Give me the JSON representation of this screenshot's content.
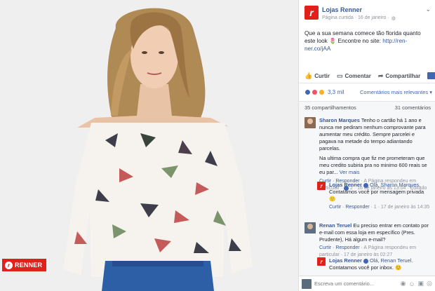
{
  "photo": {
    "brand_badge": "RENNER",
    "colors": {
      "background": "#efefef",
      "brand_red": "#e1201b",
      "denim": "#2d5fa6",
      "hair": "#b08a55"
    }
  },
  "post": {
    "page_name": "Lojas Renner",
    "meta": "Página curtida · 16 de janeiro · ",
    "caption_text": "Que a sua semana comece tão florida quanto este look 🌷 Encontre no site: ",
    "caption_link": "http://ren-ner.co/jAA",
    "actions": {
      "like": "Curtir",
      "comment": "Comentar",
      "share": "Compartilhar"
    },
    "reactions_count": "3,3 mil",
    "relevance_label": "Comentários mais relevantes",
    "shares_label": "35 compartilhamentos",
    "comments_label": "31 comentários"
  },
  "comments": [
    {
      "author": "Sharon Marques",
      "text": "Tenho o cartão há 1 ano e nunca me pediram nenhum comprovante para aumentar meu crédito. Sempre parcelei e pagava na metade do tempo adiantando parcelas.",
      "text2": "Na ultima compra que fiz me prometeram que meu credito subiria pra no minimo 600 reais se eu par... ",
      "more": "Ver mais",
      "footer_links": "Curtir · Responder",
      "footer_meta": " · A Página respondeu em particular · ",
      "footer_tail": "2 · 16 de janeiro às 13:04 · Editado"
    },
    {
      "author": "Lojas Renner",
      "mention": "Olá, Sharon Marques.",
      "text": " Contatamos você por mensagem privada 🙂",
      "footer_links": "Curtir · Responder",
      "footer_meta": " · 1 · 17 de janeiro às 14:35"
    },
    {
      "author": "Renan Teruel",
      "text": "Eu preciso entrar em contato por e-mail com essa loja em específico (Pres. Prudente), Há algum e-mail?",
      "footer_links": "Curtir · Responder",
      "footer_meta": " · A Página respondeu em particular · 17 de janeiro às 02:27"
    },
    {
      "author": "Lojas Renner",
      "mention": "Olá, Renan Teruel.",
      "text": " Contatamos você por inbox. 😊"
    }
  ],
  "composer": {
    "placeholder": "Escreva um comentário..."
  }
}
